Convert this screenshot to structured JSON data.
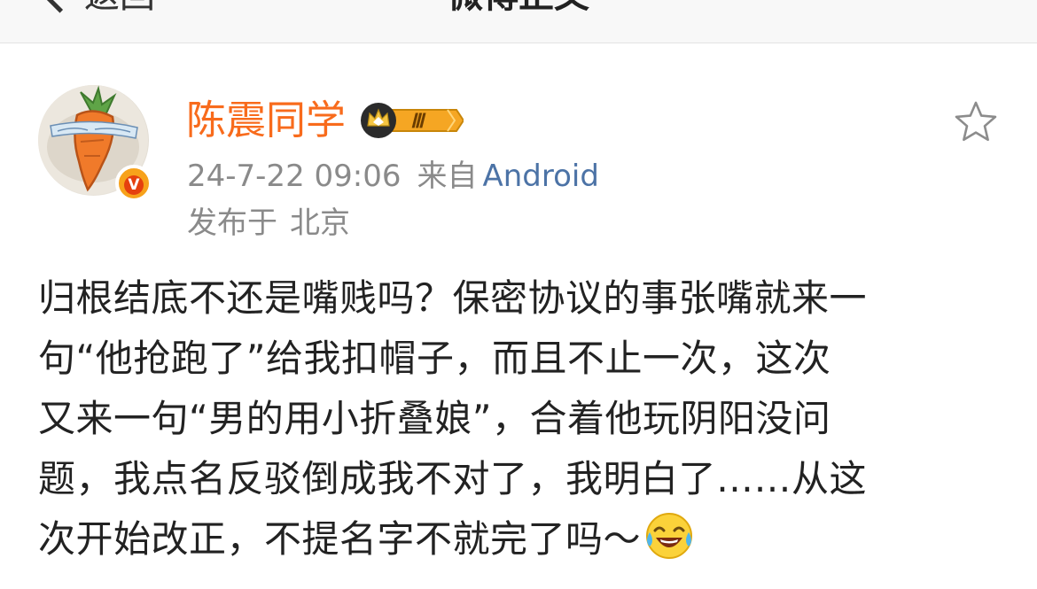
{
  "nav": {
    "back_label": "返回",
    "title": "微博正文",
    "more_icon": "more-dots-icon"
  },
  "post": {
    "author": {
      "name": "陈震同学",
      "avatar_icon": "carrot-avatar",
      "verified_icon": "verified-v-icon",
      "verified_mark": "V",
      "member_badge_icon": "crown-level-badge-icon",
      "member_level": "Ⅲ"
    },
    "timestamp": "24-7-22 09:06",
    "source_prefix": "来自",
    "source": "Android",
    "location_prefix": "发布于",
    "location": "北京",
    "favorite_icon": "star-outline-icon",
    "body_lines": [
      "归根结底不还是嘴贱吗？保密协议的事张嘴就来一",
      "句“他抢跑了”给我扣帽子，而且不止一次，这次",
      "又来一句“男的用小折叠娘”，合着他玩阴阳没问",
      "题，我点名反驳倒成我不对了，我明白了……从这",
      "次开始改正，不提名字不就完了吗～"
    ],
    "emoji_icon": "laughing-tears-icon"
  },
  "colors": {
    "username": "#f86b1c",
    "link": "#4c73a6",
    "meta": "#8a8a8a",
    "verified": "#f7a21b"
  }
}
